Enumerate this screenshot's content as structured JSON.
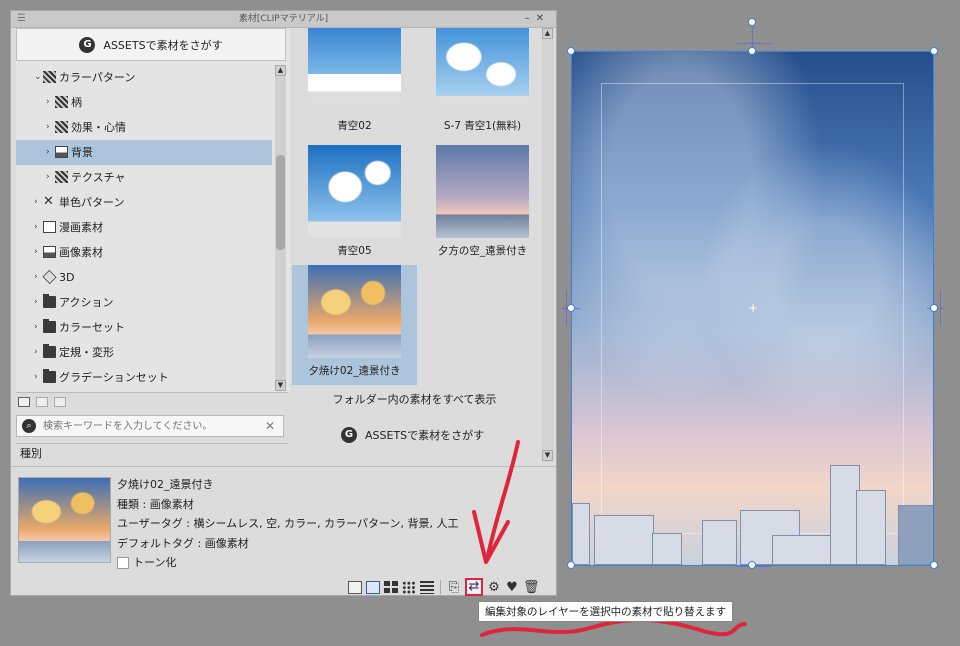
{
  "panel": {
    "title": "素材[CLIPマテリアル]",
    "assets_button": "ASSETSで素材をさがす",
    "tree": [
      {
        "label": "カラーパターン",
        "arrow": "⌄",
        "level": 0,
        "icon": "pattern"
      },
      {
        "label": "柄",
        "arrow": "›",
        "level": 1,
        "icon": "pattern"
      },
      {
        "label": "効果・心情",
        "arrow": "›",
        "level": 1,
        "icon": "pattern"
      },
      {
        "label": "背景",
        "arrow": "›",
        "level": 1,
        "icon": "image",
        "selected": true
      },
      {
        "label": "テクスチャ",
        "arrow": "›",
        "level": 1,
        "icon": "pattern"
      },
      {
        "label": "単色パターン",
        "arrow": "›",
        "level": 0,
        "icon": "x"
      },
      {
        "label": "漫画素材",
        "arrow": "›",
        "level": 0,
        "icon": "box"
      },
      {
        "label": "画像素材",
        "arrow": "›",
        "level": 0,
        "icon": "image"
      },
      {
        "label": "3D",
        "arrow": "›",
        "level": 0,
        "icon": "cube"
      },
      {
        "label": "アクション",
        "arrow": "›",
        "level": 0,
        "icon": "folder"
      },
      {
        "label": "カラーセット",
        "arrow": "›",
        "level": 0,
        "icon": "folder"
      },
      {
        "label": "定規・変形",
        "arrow": "›",
        "level": 0,
        "icon": "folder"
      },
      {
        "label": "グラデーションセット",
        "arrow": "›",
        "level": 0,
        "icon": "folder"
      }
    ],
    "search_placeholder": "検索キーワードを入力してください。",
    "kind_label": "種別",
    "thumbnails": [
      {
        "caption": "青空02",
        "style": "sky1"
      },
      {
        "caption": "S-7 青空1(無料)",
        "style": "sky2"
      },
      {
        "caption": "青空05",
        "style": "sky3"
      },
      {
        "caption": "夕方の空_遠景付き",
        "style": "sky4"
      },
      {
        "caption": "夕焼け02_遠景付き",
        "style": "sky5",
        "selected": true
      }
    ],
    "show_all": "フォルダー内の素材をすべて表示",
    "assets_bottom": "ASSETSで素材をさがす",
    "detail": {
      "name": "夕焼け02_遠景付き",
      "kind": "種類 : 画像素材",
      "user_tags": "ユーザータグ : 横シームレス, 空, カラー, カラーパターン, 背景, 人工",
      "default_tag": "デフォルトタグ : 画像素材",
      "tone": "トーン化"
    }
  },
  "tooltip": "編集対象のレイヤーを選択中の素材で貼り替えます",
  "colors": {
    "accent": "#e0243a",
    "selection": "#adc4dd",
    "canvas_border": "#3d80d8"
  }
}
